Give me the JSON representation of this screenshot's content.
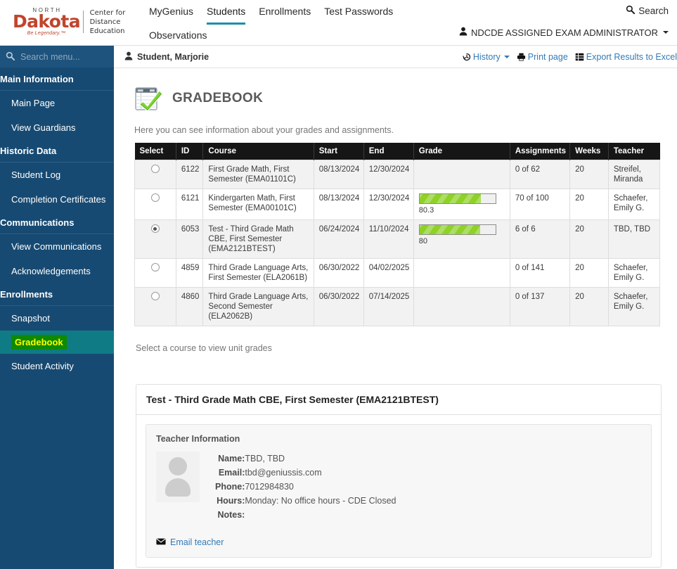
{
  "brand": {
    "north": "NORTH",
    "dakota": "Dakota",
    "tagline": "Be Legendary.™",
    "center_line1": "Center for",
    "center_line2": "Distance Education"
  },
  "topnav": {
    "items": [
      {
        "label": "MyGenius",
        "active": false
      },
      {
        "label": "Students",
        "active": true
      },
      {
        "label": "Enrollments",
        "active": false
      },
      {
        "label": "Test Passwords",
        "active": false
      },
      {
        "label": "Observations",
        "active": false
      }
    ],
    "search_label": "Search",
    "user_label": "NDCDE ASSIGNED EXAM ADMINISTRATOR"
  },
  "sidebar": {
    "search_placeholder": "Search menu...",
    "groups": [
      {
        "title": "Main Information",
        "items": [
          "Main Page",
          "View Guardians"
        ]
      },
      {
        "title": "Historic Data",
        "items": [
          "Student Log",
          "Completion Certificates"
        ]
      },
      {
        "title": "Communications",
        "items": [
          "View Communications",
          "Acknowledgements"
        ]
      },
      {
        "title": "Enrollments",
        "items": [
          "Snapshot",
          "Gradebook",
          "Student Activity"
        ]
      }
    ],
    "selected": "Gradebook"
  },
  "crumb": {
    "student": "Student, Marjorie",
    "history": "History",
    "print": "Print page",
    "export": "Export Results to Excel"
  },
  "page": {
    "title": "GRADEBOOK",
    "description": "Here you can see information about your grades and assignments.",
    "hint": "Select a course to view unit grades"
  },
  "table": {
    "columns": [
      "Select",
      "ID",
      "Course",
      "Start",
      "End",
      "Grade",
      "Assignments",
      "Weeks",
      "Teacher"
    ],
    "rows": [
      {
        "selected": false,
        "id": "6122",
        "course": "First Grade Math, First Semester (EMA01101C)",
        "start": "08/13/2024",
        "end": "12/30/2024",
        "grade": null,
        "grade_pct": null,
        "assignments": "0 of 62",
        "weeks": "20",
        "teacher": "Streifel, Miranda"
      },
      {
        "selected": false,
        "id": "6121",
        "course": "Kindergarten Math, First Semester (EMA00101C)",
        "start": "08/13/2024",
        "end": "12/30/2024",
        "grade": "80.3",
        "grade_pct": 80.3,
        "assignments": "70 of 100",
        "weeks": "20",
        "teacher": "Schaefer, Emily G."
      },
      {
        "selected": true,
        "id": "6053",
        "course": "Test - Third Grade Math CBE, First Semester (EMA2121BTEST)",
        "start": "06/24/2024",
        "end": "11/10/2024",
        "grade": "80",
        "grade_pct": 80,
        "assignments": "6 of 6",
        "weeks": "20",
        "teacher": "TBD, TBD"
      },
      {
        "selected": false,
        "id": "4859",
        "course": "Third Grade Language Arts, First Semester (ELA2061B)",
        "start": "06/30/2022",
        "end": "04/02/2025",
        "grade": null,
        "grade_pct": null,
        "assignments": "0 of 141",
        "weeks": "20",
        "teacher": "Schaefer, Emily G."
      },
      {
        "selected": false,
        "id": "4860",
        "course": "Third Grade Language Arts, Second Semester (ELA2062B)",
        "start": "06/30/2022",
        "end": "07/14/2025",
        "grade": null,
        "grade_pct": null,
        "assignments": "0 of 137",
        "weeks": "20",
        "teacher": "Schaefer, Emily G."
      }
    ]
  },
  "panel": {
    "title": "Test - Third Grade Math CBE, First Semester (EMA2121BTEST)",
    "teacher_info_title": "Teacher Information",
    "fields": [
      {
        "label": "Name:",
        "value": "TBD, TBD"
      },
      {
        "label": "Email:",
        "value": "tbd@geniussis.com"
      },
      {
        "label": "Phone:",
        "value": "7012984830"
      },
      {
        "label": "Hours:",
        "value": "Monday: No office hours - CDE Closed"
      },
      {
        "label": "Notes:",
        "value": ""
      }
    ],
    "email_teacher": "Email teacher"
  },
  "colors": {
    "sidebar_bg": "#174a72",
    "selected_menu_bg": "#0f7b85",
    "highlight_bg": "#0f8a00",
    "highlight_text": "#ffff00",
    "brand_red": "#c0452c",
    "link_blue": "#337ab7",
    "progress_green": "#8ed127",
    "active_tab_underline": "#1b8fa8"
  }
}
